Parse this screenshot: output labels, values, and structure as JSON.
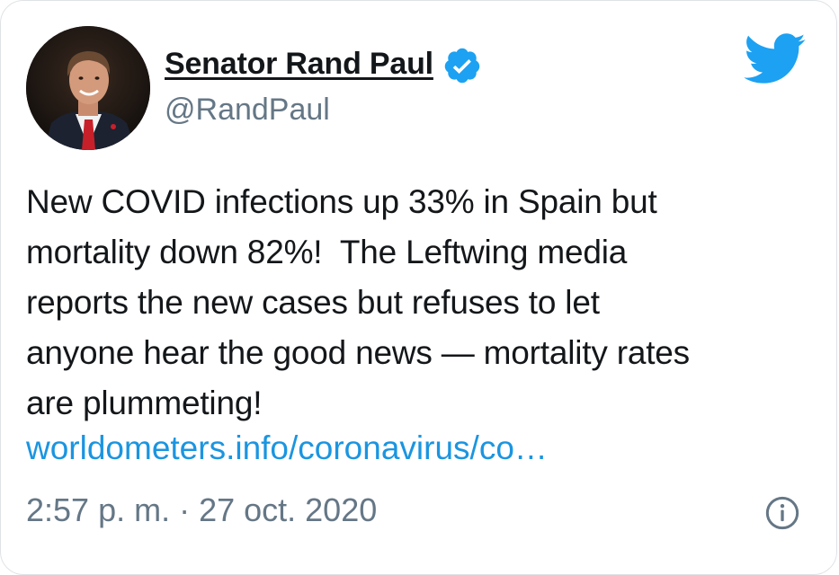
{
  "author": {
    "display_name": "Senator Rand Paul",
    "handle": "@RandPaul",
    "verified": true
  },
  "tweet": {
    "text_lines": [
      "New COVID infections up 33% in Spain but",
      "mortality down 82%!  The Leftwing media",
      "reports the new cases but refuses to let",
      "anyone hear the good news — mortality rates",
      "are plummeting!"
    ],
    "link": "worldometers.info/coronavirus/co…",
    "timestamp": "2:57 p. m. · 27 oct. 2020"
  },
  "icons": {
    "brand": "twitter-bird-icon",
    "verified": "verified-badge-icon",
    "info": "info-icon"
  },
  "colors": {
    "twitter_blue": "#1da1f2",
    "link_blue": "#1b95e0",
    "text": "#14171a",
    "muted": "#657786"
  }
}
